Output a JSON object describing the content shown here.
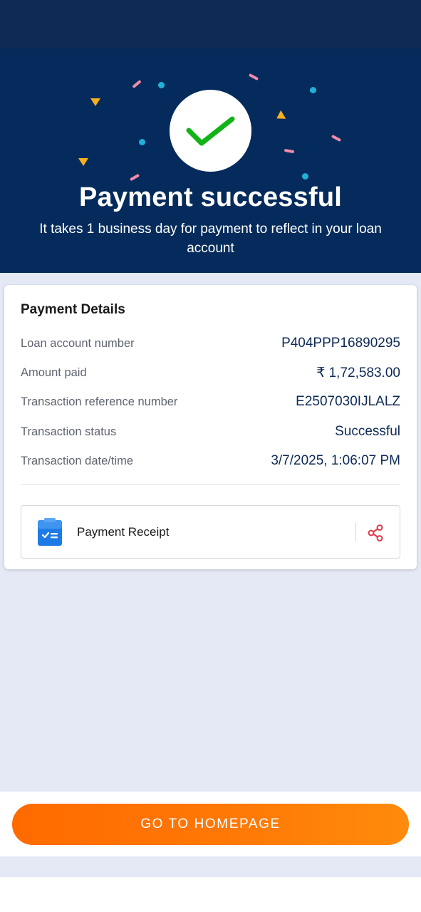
{
  "hero": {
    "title": "Payment successful",
    "subtitle": "It takes 1 business day for payment to reflect in your loan account",
    "check_icon": "checkmark-icon",
    "colors": {
      "background": "#052b5c",
      "check": "#12b317"
    }
  },
  "details": {
    "title": "Payment Details",
    "rows": [
      {
        "label": "Loan account number",
        "value": "P404PPP16890295"
      },
      {
        "label": "Amount paid",
        "value": "₹ 1,72,583.00"
      },
      {
        "label": "Transaction reference number",
        "value": "E2507030IJLALZ"
      },
      {
        "label": "Transaction status",
        "value": "Successful"
      },
      {
        "label": "Transaction date/time",
        "value": "3/7/2025, 1:06:07 PM"
      }
    ]
  },
  "receipt": {
    "label": "Payment Receipt",
    "icon": "receipt-icon",
    "share_icon": "share-icon"
  },
  "footer": {
    "button_label": "GO TO HOMEPAGE",
    "button_color": "#ff6a00"
  }
}
